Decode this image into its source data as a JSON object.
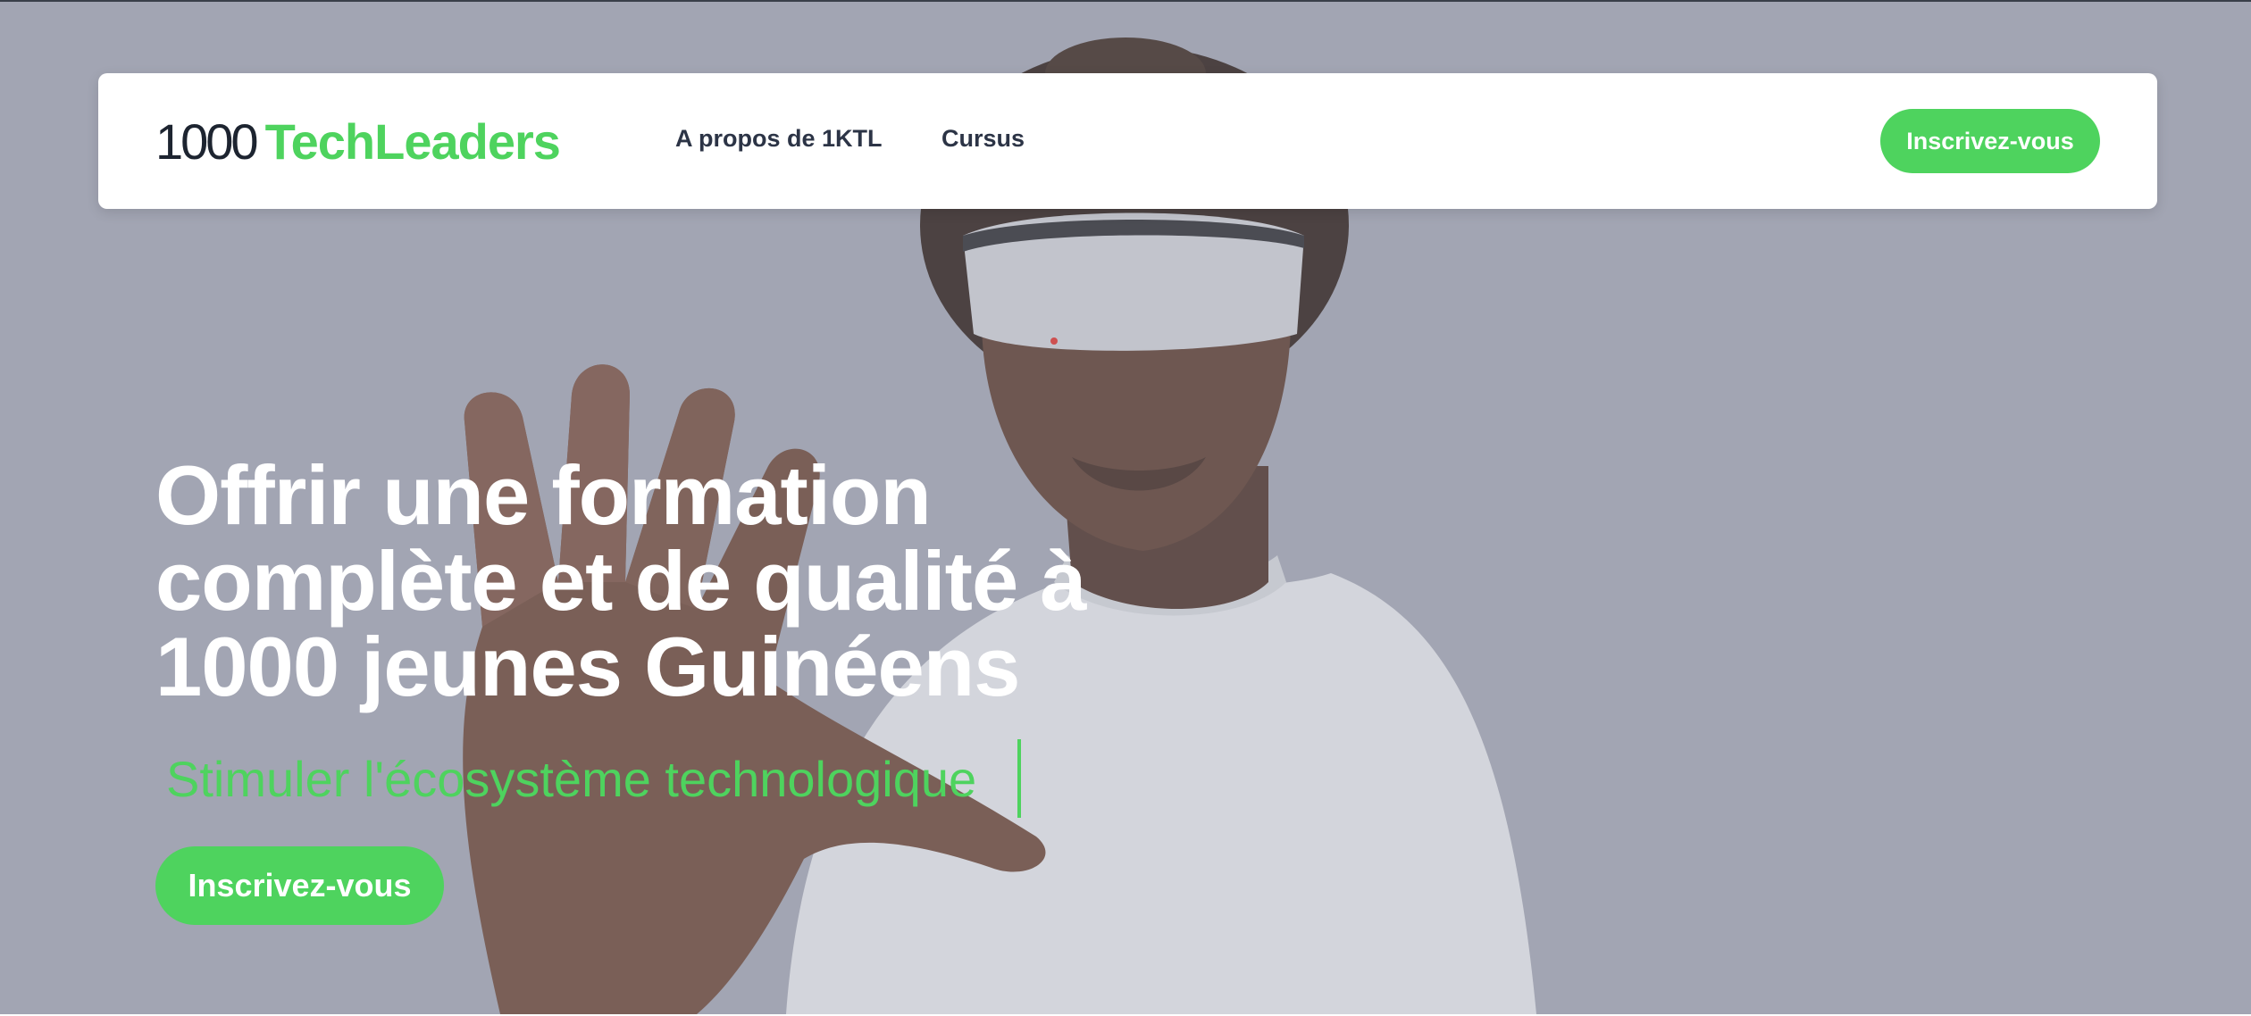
{
  "brand": {
    "number": "1000",
    "name": "TechLeaders",
    "accent_color": "#4ed35e",
    "dark_color": "#1d2430"
  },
  "nav": {
    "items": [
      {
        "label": "A propos de 1KTL"
      },
      {
        "label": "Cursus"
      }
    ],
    "cta_label": "Inscrivez-vous"
  },
  "hero": {
    "headline": "Offrir une formation complète et de qualité à 1000 jeunes Guinéens",
    "tagline": "Stimuler l'écosystème technologique",
    "cta_label": "Inscrivez-vous",
    "background_color": "#a3a6b3"
  }
}
